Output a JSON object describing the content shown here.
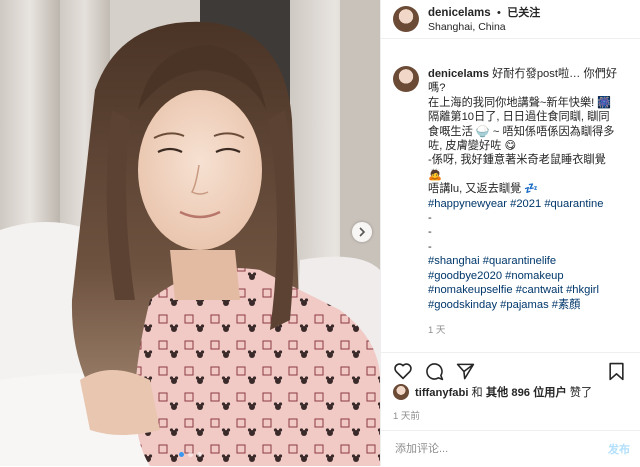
{
  "post": {
    "username": "denicelams",
    "header_separator": "•",
    "follow_status": "已关注",
    "location": "Shanghai, China",
    "caption_lines": [
      {
        "text": "好耐冇發post啦… 你們好",
        "type": "text",
        "prefix_user": true
      },
      {
        "text": "嗎?",
        "type": "text"
      },
      {
        "text": "在上海的我同你地講聲~新年快樂! 🎆",
        "type": "text"
      },
      {
        "text": "隔離第10日了, 日日過住食同瞓, 瞓同",
        "type": "text"
      },
      {
        "text": "食嘅生活 🍚 ~ 唔知係唔係因為瞓得多",
        "type": "text"
      },
      {
        "text": "咗, 皮膚變好咗 😋",
        "type": "text"
      },
      {
        "text": "-係呀, 我好鍾意著米奇老鼠睡衣瞓覺",
        "type": "text"
      },
      {
        "text": "🙇",
        "type": "text"
      },
      {
        "text": "唔講lu, 又返去瞓覺 💤",
        "type": "text"
      },
      {
        "text": "#happynewyear #2021 #quarantine",
        "type": "tag"
      },
      {
        "text": "-",
        "type": "text"
      },
      {
        "text": "-",
        "type": "text"
      },
      {
        "text": "-",
        "type": "text"
      },
      {
        "text": "#shanghai #quarantinelife",
        "type": "tag"
      },
      {
        "text": "#goodbye2020 #nomakeup",
        "type": "tag"
      },
      {
        "text": "#nomakeupselfie #cantwait #hkgirl",
        "type": "tag"
      },
      {
        "text": "#goodskinday #pajamas #素顏",
        "type": "tag"
      }
    ],
    "caption_time": "1 天",
    "likes": {
      "liker": "tiffanyfabi",
      "and_text": " 和 ",
      "others_text": "其他 896 位用户",
      "suffix": " 赞了"
    },
    "date": "1 天前",
    "comment_placeholder": "添加评论...",
    "post_button": "发布"
  },
  "icons": {
    "like": "heart-icon",
    "comment": "comment-icon",
    "share": "share-icon",
    "save": "bookmark-icon",
    "next": "chevron-right-icon"
  },
  "colors": {
    "hashtag": "#00376b",
    "muted": "#8e8e8e",
    "post_button": "#b2dffc",
    "carousel_active_dot": "#3897f0"
  },
  "carousel": {
    "count": 3,
    "active": 1
  }
}
